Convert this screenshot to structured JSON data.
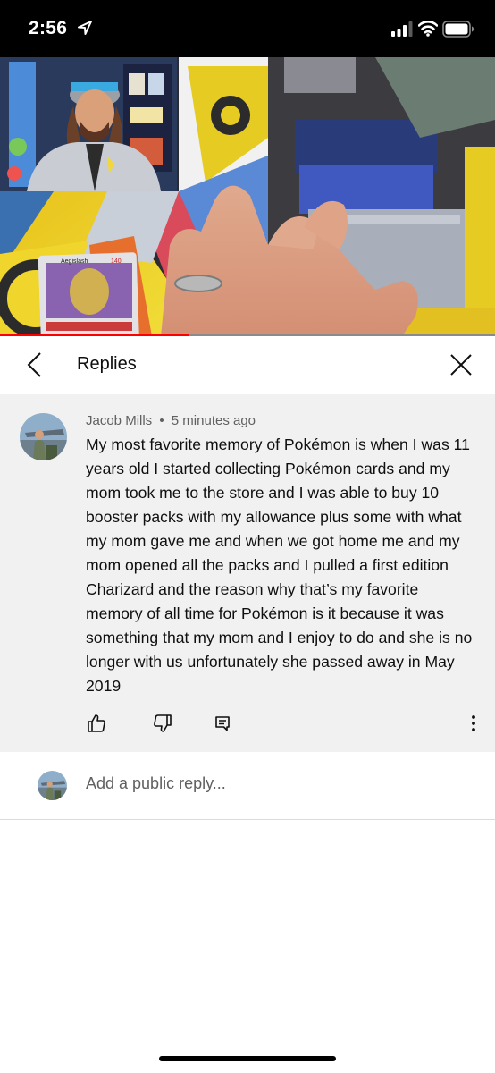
{
  "status_bar": {
    "time": "2:56",
    "icons": [
      "location-arrow-icon",
      "cellular-signal-icon",
      "wifi-icon",
      "battery-icon"
    ]
  },
  "video": {
    "description_icons": [
      "video-thumbnail"
    ],
    "card_name": "Aegislash",
    "card_hp": "140",
    "progress": 0.38,
    "progress_color": "#ff0000"
  },
  "replies_header": {
    "title": "Replies",
    "back_icon": "chevron-left-icon",
    "close_icon": "close-icon"
  },
  "comment": {
    "author": "Jacob Mills",
    "separator": "•",
    "time": "5 minutes ago",
    "text": "My most favorite memory of Pokémon is when I was 11 years old I started collecting Pokémon cards and my mom took me to the store and I was able to buy 10 booster packs with my allowance plus some with what my mom gave me and when we got home me and my mom opened all the packs and I pulled a first edition Charizard and the reason why that’s my favorite memory of all time for Pokémon is it because it was something that my mom and I enjoy to do and she is no longer with us unfortunately she passed away in May 2019",
    "actions": [
      "thumbs-up-icon",
      "thumbs-down-icon",
      "reply-icon",
      "more-vert-icon"
    ]
  },
  "reply_bar": {
    "placeholder": "Add a public reply..."
  },
  "colors": {
    "comment_bg": "#f1f1f1",
    "meta_text": "#606060",
    "accent": "#ff0000"
  }
}
